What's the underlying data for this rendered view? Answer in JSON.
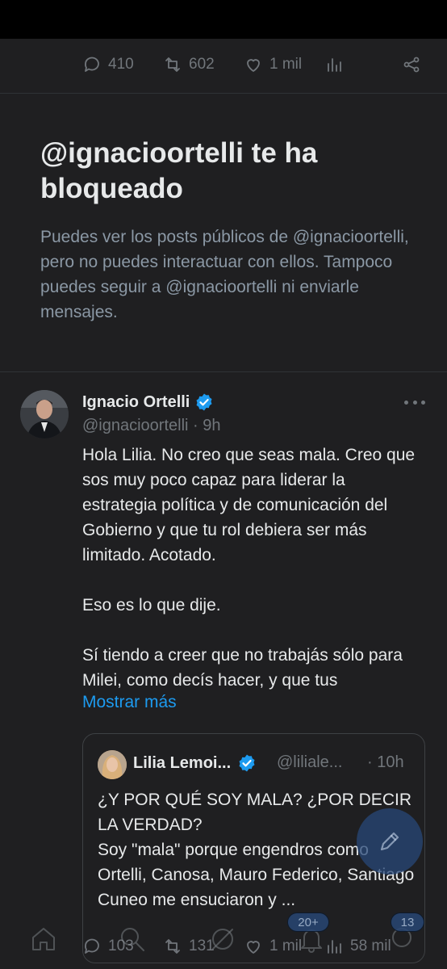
{
  "top_actions": {
    "replies": "410",
    "reposts": "602",
    "likes": "1 mil",
    "views_icon": "bar-chart-icon",
    "share_icon": "share-icon"
  },
  "blocked_notice": {
    "title": "@ignacioortelli te ha bloqueado",
    "body": "Puedes ver los posts públicos de @ignacioortelli, pero no puedes interactuar con ellos. Tampoco puedes seguir a @ignacioortelli ni enviarle mensajes."
  },
  "tweet": {
    "author_name": "Ignacio Ortelli",
    "handle": "@ignacioortelli",
    "separator": " · ",
    "time": "9h",
    "text": "Hola Lilia. No creo que seas mala. Creo que sos muy poco capaz para liderar la estrategia política y de comunicación del Gobierno y que tu rol debiera ser más limitado. Acotado.\n\nEso es lo que dije.\n\nSí tiendo a creer que no trabajás sólo para Milei, como decís hacer, y que tus",
    "show_more": "Mostrar más",
    "quote": {
      "author_name": "Lilia Lemoi...",
      "handle": "@liliale...",
      "time": "· 10h",
      "text": "¿Y POR QUÉ SOY MALA? ¿POR DECIR LA VERDAD?\nSoy \"mala\" porque engendros como Ortelli, Canosa, Mauro Federico, Santiago Cuneo me ensuciaron y ..."
    }
  },
  "bottom_actions": {
    "replies": "103",
    "reposts": "131",
    "likes": "1 mil",
    "views": "58 mil"
  },
  "nav": {
    "notifications_badge": "20+",
    "messages_badge": "13"
  },
  "colors": {
    "background": "#1f1f21",
    "accent": "#1d9bf0",
    "text": "#e7e9ea",
    "muted": "#71767b"
  }
}
